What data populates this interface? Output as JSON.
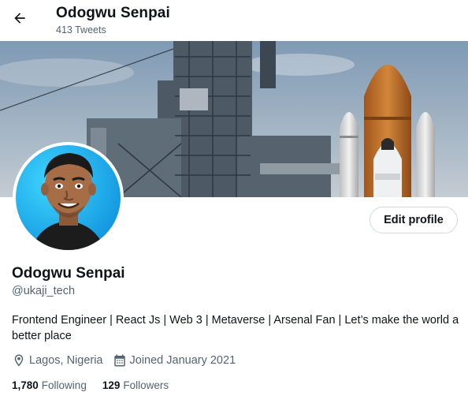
{
  "header": {
    "name": "Odogwu Senpai",
    "tweet_count": "413 Tweets"
  },
  "profile": {
    "name": "Odogwu Senpai",
    "handle": "@ukaji_tech",
    "bio": "Frontend Engineer | React Js | Web 3 | Metaverse | Arsenal Fan | Let’s make the world a better place",
    "location": "Lagos, Nigeria",
    "joined": "Joined January 2021",
    "edit_button_label": "Edit profile"
  },
  "stats": {
    "following_count": "1,780",
    "following_label": "Following",
    "followers_count": "129",
    "followers_label": "Followers"
  },
  "icons": {
    "back": "arrow-left-icon",
    "location": "map-pin-icon",
    "joined": "calendar-icon"
  },
  "colors": {
    "text_primary": "#0f1419",
    "text_secondary": "#536471",
    "border": "#cfd9de",
    "avatar_bg": "#1da1f2"
  }
}
